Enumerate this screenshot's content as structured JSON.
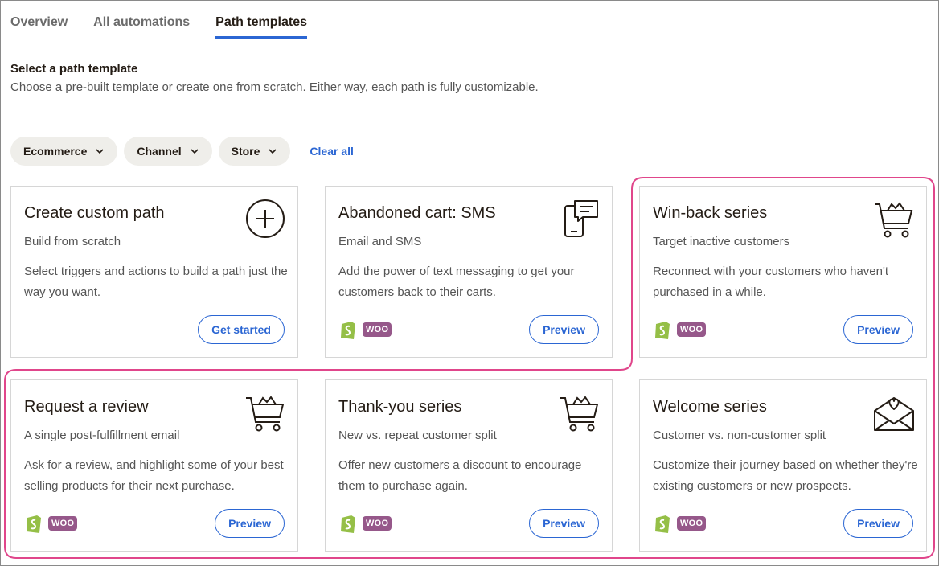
{
  "tabs": [
    {
      "label": "Overview"
    },
    {
      "label": "All automations"
    },
    {
      "label": "Path templates"
    }
  ],
  "heading": "Select a path template",
  "subheading": "Choose a pre-built template or create one from scratch. Either way, each path is fully customizable.",
  "filters": [
    {
      "label": "Ecommerce"
    },
    {
      "label": "Channel"
    },
    {
      "label": "Store"
    }
  ],
  "clear_all": "Clear all",
  "integrations": {
    "woo_label": "WOO"
  },
  "accent_color": "#2b66d3",
  "highlight_color": "#e0468b",
  "cards": [
    {
      "title": "Create custom path",
      "subtitle": "Build from scratch",
      "description": "Select triggers and actions to build a path just the way you want.",
      "button": "Get started",
      "icon": "plus-circle-icon"
    },
    {
      "title": "Abandoned cart: SMS",
      "subtitle": "Email and SMS",
      "description": "Add the power of text messaging to get your customers back to their carts.",
      "button": "Preview",
      "icon": "phone-message-icon"
    },
    {
      "title": "Win-back series",
      "subtitle": "Target inactive customers",
      "description": "Reconnect with your customers who haven't purchased in a while.",
      "button": "Preview",
      "icon": "shopping-cart-icon"
    },
    {
      "title": "Request a review",
      "subtitle": "A single post-fulfillment email",
      "description": "Ask for a review, and highlight some of your best selling products for their next purchase.",
      "button": "Preview",
      "icon": "shopping-cart-icon"
    },
    {
      "title": "Thank-you series",
      "subtitle": "New vs. repeat customer split",
      "description": "Offer new customers a discount to encourage them to purchase again.",
      "button": "Preview",
      "icon": "shopping-cart-icon"
    },
    {
      "title": "Welcome series",
      "subtitle": "Customer vs. non-customer split",
      "description": "Customize their journey based on whether they're existing customers or new prospects.",
      "button": "Preview",
      "icon": "envelope-heart-icon"
    }
  ]
}
